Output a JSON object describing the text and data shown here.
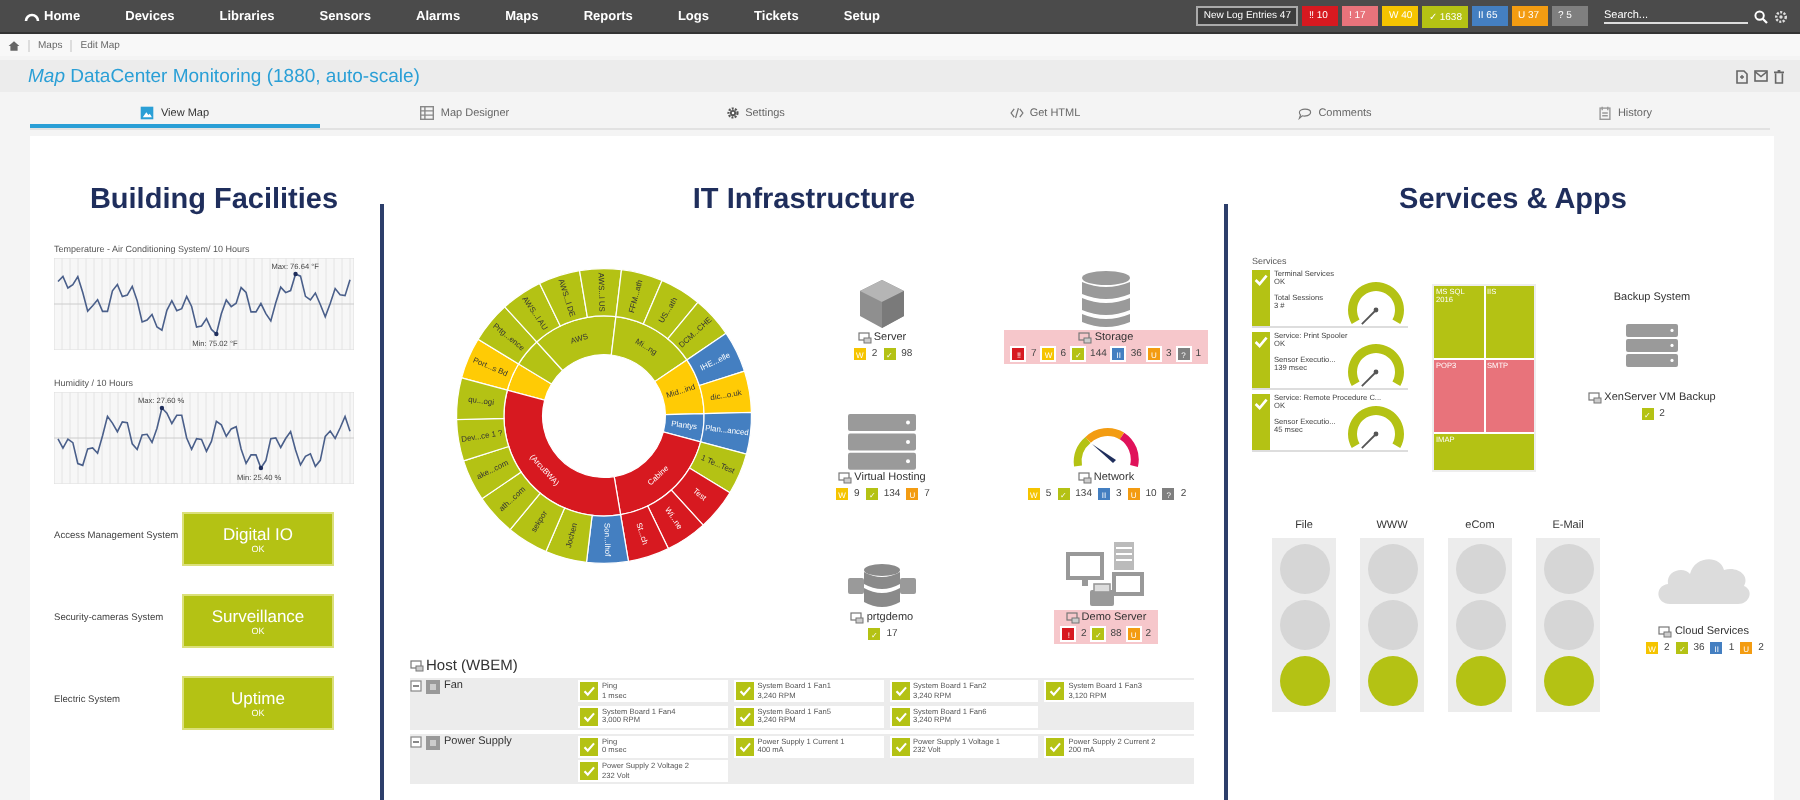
{
  "nav": {
    "items": [
      "Home",
      "Devices",
      "Libraries",
      "Sensors",
      "Alarms",
      "Maps",
      "Reports",
      "Logs",
      "Tickets",
      "Setup"
    ],
    "log_entries": {
      "label": "New Log Entries",
      "count": "47"
    },
    "status_counts": [
      {
        "color": "#d71920",
        "symbol": "‼",
        "count": "10"
      },
      {
        "color": "#e8737b",
        "symbol": "!",
        "count": "17"
      },
      {
        "color": "#f5c400",
        "symbol": "W",
        "count": "40"
      },
      {
        "color": "#b4c214",
        "symbol": "✓",
        "count": "1638"
      },
      {
        "color": "#447fc1",
        "symbol": "II",
        "count": "65"
      },
      {
        "color": "#f39c12",
        "symbol": "U",
        "count": "37"
      },
      {
        "color": "#7f7f7f",
        "symbol": "?",
        "count": "5"
      }
    ],
    "search": {
      "placeholder": "Search..."
    }
  },
  "breadcrumb": [
    "Maps",
    "Edit Map"
  ],
  "title": "*Map* DataCenter Monitoring (1880, auto-scale)",
  "tabs": [
    {
      "label": "View Map",
      "kind": "picture",
      "selected": true
    },
    {
      "label": "Map Designer",
      "kind": "grid",
      "selected": false
    },
    {
      "label": "Settings",
      "kind": "gear",
      "selected": false
    },
    {
      "label": "Get HTML",
      "kind": "code",
      "selected": false
    },
    {
      "label": "Comments",
      "kind": "comment",
      "selected": false
    },
    {
      "label": "History",
      "kind": "history",
      "selected": false
    }
  ],
  "building": {
    "heading": "Building Facilities",
    "charts": [
      {
        "title": "Temperature - Air Conditioning System/ 10 Hours",
        "max_label": "Max: 76.64 °F",
        "min_label": "Min: 75.02 °F"
      },
      {
        "title": "Humidity / 10 Hours",
        "max_label": "Max: 27.60 %",
        "min_label": "Min: 25.40 %"
      }
    ],
    "systems": [
      {
        "label": "Access Management System",
        "title": "Digital IO",
        "status_text": "OK",
        "color": "#b4c214"
      },
      {
        "label": "Security-cameras System",
        "title": "Surveillance",
        "status_text": "OK",
        "color": "#b4c214"
      },
      {
        "label": "Electric System",
        "title": "Uptime",
        "status_text": "OK",
        "color": "#b4c214"
      }
    ]
  },
  "it": {
    "heading": "IT Infrastructure",
    "sunburst": [
      {
        "color": "#ffcb05",
        "children": [
          {
            "label": "Port...s Bd",
            "color": "#ffcb05"
          }
        ]
      },
      {
        "color": "#b4c214",
        "children": [
          {
            "label": "Prtg...ence",
            "color": "#b4c214"
          }
        ]
      },
      {
        "color": "#b4c214",
        "label": "AWS",
        "children": [
          {
            "label": "AWS...l AU",
            "color": "#b4c214"
          },
          {
            "label": "AWS...l DE",
            "color": "#b4c214"
          },
          {
            "label": "AWS...l US",
            "color": "#b4c214"
          }
        ]
      },
      {
        "color": "#b4c214",
        "label": "Mi...ng",
        "children": [
          {
            "label": "FFM...ath",
            "color": "#b4c214"
          },
          {
            "label": "US...ath",
            "color": "#b4c214"
          },
          {
            "label": "DCM...CHE",
            "color": "#b4c214"
          }
        ]
      },
      {
        "color": "#ffcb05",
        "label": "Mid...ind",
        "children": [
          {
            "label": "IHE...elle",
            "color": "#447fc1"
          },
          {
            "label": "dic...o.uk",
            "color": "#ffcb05"
          }
        ]
      },
      {
        "color": "#447fc1",
        "label": "Plantys",
        "children": [
          {
            "label": "Plan...anced",
            "color": "#447fc1"
          }
        ]
      },
      {
        "color": "#d71920",
        "label": "Cabine",
        "children": [
          {
            "label": "1 Te...Test",
            "color": "#b4c214"
          },
          {
            "label": "Test",
            "color": "#d71920"
          },
          {
            "label": "Wi...ne",
            "color": "#d71920"
          },
          {
            "label": "St...ch",
            "color": "#d71920"
          }
        ]
      },
      {
        "color": "#d71920",
        "label": "(ArcuBWA)",
        "children": [
          {
            "label": "Son...lhof",
            "color": "#447fc1"
          },
          {
            "label": "Jochen",
            "color": "#b4c214"
          },
          {
            "label": "sekpor",
            "color": "#b4c214"
          },
          {
            "label": "ath...com",
            "color": "#b4c214"
          },
          {
            "label": "ake...com",
            "color": "#b4c214"
          },
          {
            "label": "Dev...ce 1 ?",
            "color": "#b4c214"
          },
          {
            "label": "qu...ogi",
            "color": "#b4c214"
          }
        ]
      }
    ],
    "devices": [
      {
        "name": "Server",
        "kind": "cube",
        "alert": false,
        "counts": [
          {
            "color": "#f5c400",
            "symbol": "W",
            "count": "2"
          },
          {
            "color": "#b4c214",
            "symbol": "✓",
            "count": "98"
          }
        ]
      },
      {
        "name": "Storage",
        "kind": "database",
        "alert": true,
        "counts": [
          {
            "color": "#d71920",
            "symbol": "‼",
            "count": "7"
          },
          {
            "color": "#f5c400",
            "symbol": "W",
            "count": "6"
          },
          {
            "color": "#b4c214",
            "symbol": "✓",
            "count": "144"
          },
          {
            "color": "#447fc1",
            "symbol": "II",
            "count": "36"
          },
          {
            "color": "#f39c12",
            "symbol": "U",
            "count": "3"
          },
          {
            "color": "#7f7f7f",
            "symbol": "?",
            "count": "1"
          }
        ]
      },
      {
        "name": "Virtual Hosting",
        "kind": "servers",
        "alert": false,
        "counts": [
          {
            "color": "#f5c400",
            "symbol": "W",
            "count": "9"
          },
          {
            "color": "#b4c214",
            "symbol": "✓",
            "count": "134"
          },
          {
            "color": "#f39c12",
            "symbol": "U",
            "count": "7"
          }
        ]
      },
      {
        "name": "Network",
        "kind": "gauge",
        "alert": false,
        "counts": [
          {
            "color": "#f5c400",
            "symbol": "W",
            "count": "5"
          },
          {
            "color": "#b4c214",
            "symbol": "✓",
            "count": "134"
          },
          {
            "color": "#447fc1",
            "symbol": "II",
            "count": "3"
          },
          {
            "color": "#f39c12",
            "symbol": "U",
            "count": "10"
          },
          {
            "color": "#7f7f7f",
            "symbol": "?",
            "count": "2"
          }
        ]
      },
      {
        "name": "prtgdemo",
        "kind": "database-plug",
        "alert": false,
        "counts": [
          {
            "color": "#b4c214",
            "symbol": "✓",
            "count": "17"
          }
        ]
      },
      {
        "name": "Demo Server",
        "kind": "computers",
        "alert": true,
        "counts": [
          {
            "color": "#d71920",
            "symbol": "!",
            "count": "2"
          },
          {
            "color": "#b4c214",
            "symbol": "✓",
            "count": "88"
          },
          {
            "color": "#f39c12",
            "symbol": "U",
            "count": "2"
          }
        ]
      }
    ],
    "host": {
      "title": "Host (WBEM)",
      "groups": [
        {
          "name": "Fan",
          "sensors": [
            {
              "name": "Ping",
              "value": "1 msec",
              "color": "#b4c214"
            },
            {
              "name": "System Board 1 Fan1",
              "value": "3,240 RPM",
              "color": "#b4c214"
            },
            {
              "name": "System Board 1 Fan2",
              "value": "3,240 RPM",
              "color": "#b4c214"
            },
            {
              "name": "System Board 1 Fan3",
              "value": "3,120 RPM",
              "color": "#b4c214"
            },
            {
              "name": "System Board 1 Fan4",
              "value": "3,000 RPM",
              "color": "#b4c214"
            },
            {
              "name": "System Board 1 Fan5",
              "value": "3,240 RPM",
              "color": "#b4c214"
            },
            {
              "name": "System Board 1 Fan6",
              "value": "3,240 RPM",
              "color": "#b4c214"
            }
          ]
        },
        {
          "name": "Power Supply",
          "sensors": [
            {
              "name": "Ping",
              "value": "0 msec",
              "color": "#b4c214"
            },
            {
              "name": "Power Supply 1 Current 1",
              "value": "400 mA",
              "color": "#b4c214"
            },
            {
              "name": "Power Supply 1 Voltage 1",
              "value": "232 Volt",
              "color": "#b4c214"
            },
            {
              "name": "Power Supply 2 Current 2",
              "value": "200 mA",
              "color": "#b4c214"
            },
            {
              "name": "Power Supply 2 Voltage 2",
              "value": "232 Volt",
              "color": "#b4c214"
            }
          ]
        }
      ]
    }
  },
  "services": {
    "heading": "Services & Apps",
    "list_title": "Services",
    "items": [
      {
        "name": "Terminal Services",
        "status_text": "OK",
        "color": "#b4c214",
        "metric": "Total Sessions",
        "value": "3 #"
      },
      {
        "name": "Service: Print Spooler",
        "status_text": "OK",
        "color": "#b4c214",
        "metric": "Sensor Executio...",
        "value": "139 msec"
      },
      {
        "name": "Service: Remote Procedure C...",
        "status_text": "OK",
        "color": "#b4c214",
        "metric": "Sensor Executio...",
        "value": "45 msec"
      }
    ],
    "treemap": [
      {
        "label": "MS SQL 2016",
        "color": "#b4c214"
      },
      {
        "label": "IIS",
        "color": "#b4c214"
      },
      {
        "label": "POP3",
        "color": "#e8737b"
      },
      {
        "label": "SMTP",
        "color": "#e8737b"
      },
      {
        "label": "IMAP",
        "color": "#b4c214"
      }
    ],
    "backup": {
      "title": "Backup System",
      "device": "XenServer VM Backup",
      "counts": [
        {
          "color": "#b4c214",
          "symbol": "✓",
          "count": "2"
        }
      ]
    },
    "lights": [
      {
        "label": "File",
        "kind": "green"
      },
      {
        "label": "WWW",
        "kind": "green"
      },
      {
        "label": "eCom",
        "kind": "green"
      },
      {
        "label": "E-Mail",
        "kind": "green"
      }
    ],
    "cloud": {
      "name": "Cloud Services",
      "counts": [
        {
          "color": "#f5c400",
          "symbol": "W",
          "count": "2"
        },
        {
          "color": "#b4c214",
          "symbol": "✓",
          "count": "36"
        },
        {
          "color": "#447fc1",
          "symbol": "II",
          "count": "1"
        },
        {
          "color": "#f39c12",
          "symbol": "U",
          "count": "2"
        }
      ]
    }
  }
}
